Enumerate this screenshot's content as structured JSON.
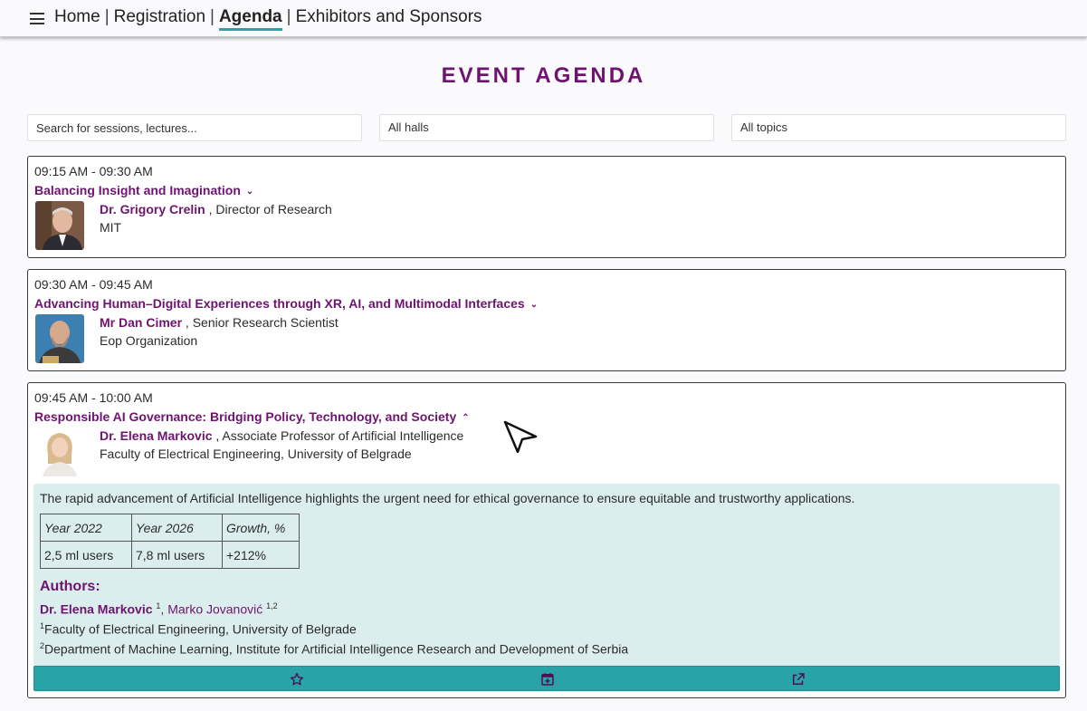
{
  "nav": {
    "menu_icon": "hamburger-menu-icon",
    "items": [
      {
        "label": "Home",
        "active": false
      },
      {
        "label": "Registration",
        "active": false
      },
      {
        "label": "Agenda",
        "active": true
      },
      {
        "label": "Exhibitors and Sponsors",
        "active": false
      }
    ],
    "separator": "|"
  },
  "page": {
    "title": "EVENT AGENDA",
    "accent_color": "#6e1470",
    "teal_color": "#2aa3a7"
  },
  "filters": {
    "search_placeholder": "Search for sessions, lectures...",
    "halls_value": "All halls",
    "topics_value": "All topics"
  },
  "sessions": [
    {
      "time": "09:15 AM - 09:30 AM",
      "title": "Balancing Insight and Imagination",
      "expanded": false,
      "chevron": "chevron-down-icon",
      "speaker_name": "Dr. Grigory Crelin",
      "speaker_role": " , Director of Research",
      "organization": "MIT"
    },
    {
      "time": "09:30 AM - 09:45 AM",
      "title": "Advancing Human–Digital Experiences through XR, AI, and Multimodal Interfaces",
      "expanded": false,
      "chevron": "chevron-down-icon",
      "speaker_name": "Mr Dan Cimer",
      "speaker_role": " , Senior Research Scientist",
      "organization": "Eop Organization"
    },
    {
      "time": "09:45 AM - 10:00 AM",
      "title": "Responsible AI Governance: Bridging Policy, Technology, and Society",
      "expanded": true,
      "chevron": "chevron-up-icon",
      "speaker_name": "Dr. Elena Markovic",
      "speaker_role": " , Associate Professor of Artificial Intelligence",
      "organization": "Faculty of Electrical Engineering, University of Belgrade",
      "abstract": "The rapid advancement of Artificial Intelligence highlights the urgent need for ethical governance to ensure equitable and trustworthy applications.",
      "table": {
        "headers": [
          "Year 2022",
          "Year 2026",
          "Growth, %"
        ],
        "row": [
          "2,5 ml users",
          "7,8 ml users",
          "+212%"
        ]
      },
      "authors_heading": "Authors:",
      "authors": {
        "first_name": "Dr. Elena Markovic",
        "first_sup": "1",
        "sep": ", ",
        "second_name": "Marko Jovanović",
        "second_sup": "1,2"
      },
      "affiliations": [
        {
          "sup": "1",
          "text": "Faculty of Electrical Engineering, University of Belgrade"
        },
        {
          "sup": "2",
          "text": "Department of Machine Learning, Institute for Artificial Intelligence Research and Development of Serbia"
        }
      ],
      "actions": [
        "star-icon",
        "calendar-add-icon",
        "open-external-icon"
      ]
    }
  ]
}
